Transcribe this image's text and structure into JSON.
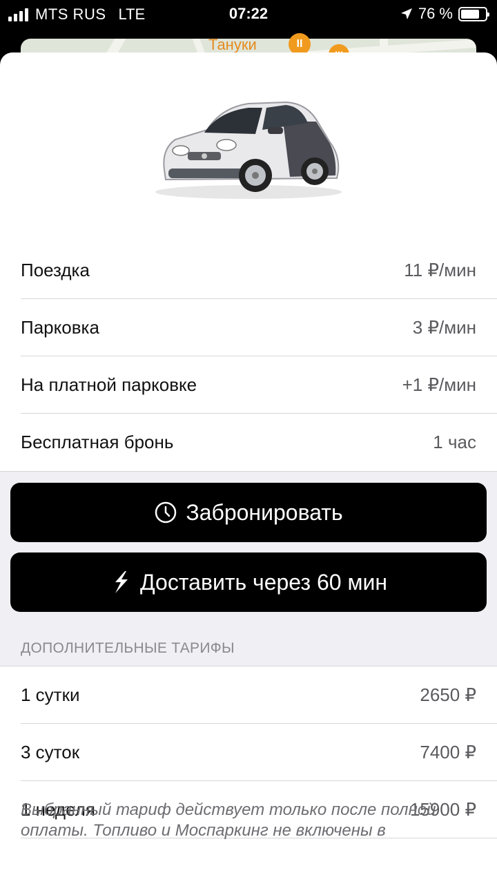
{
  "status_bar": {
    "carrier": "MTS RUS",
    "network": "LTE",
    "time": "07:22",
    "battery_percent": "76 %",
    "battery_level": 0.76
  },
  "map": {
    "place_label": "Тануки",
    "pin_icon": "restaurant-icon"
  },
  "tariffs": [
    {
      "label": "Поездка",
      "value": "11 ₽/мин"
    },
    {
      "label": "Парковка",
      "value": "3 ₽/мин"
    },
    {
      "label": "На платной парковке",
      "value": "+1 ₽/мин"
    },
    {
      "label": "Бесплатная бронь",
      "value": "1 час"
    }
  ],
  "buttons": {
    "book_label": "Забронировать",
    "book_icon": "clock-icon",
    "deliver_label": "Доставить через 60 мин",
    "deliver_icon": "lightning-icon"
  },
  "extra": {
    "header": "ДОПОЛНИТЕЛЬНЫЕ ТАРИФЫ",
    "items": [
      {
        "label": "1 сутки",
        "value": "2650 ₽"
      },
      {
        "label": "3 суток",
        "value": "7400 ₽"
      },
      {
        "label": "1 неделя",
        "value": "15900 ₽"
      }
    ],
    "footnote": "Выбранный тариф действует только после полной оплаты. Топливо и Моспаркинг не включены в"
  },
  "colors": {
    "button_bg": "#000000",
    "accent_map": "#e58a1f"
  }
}
